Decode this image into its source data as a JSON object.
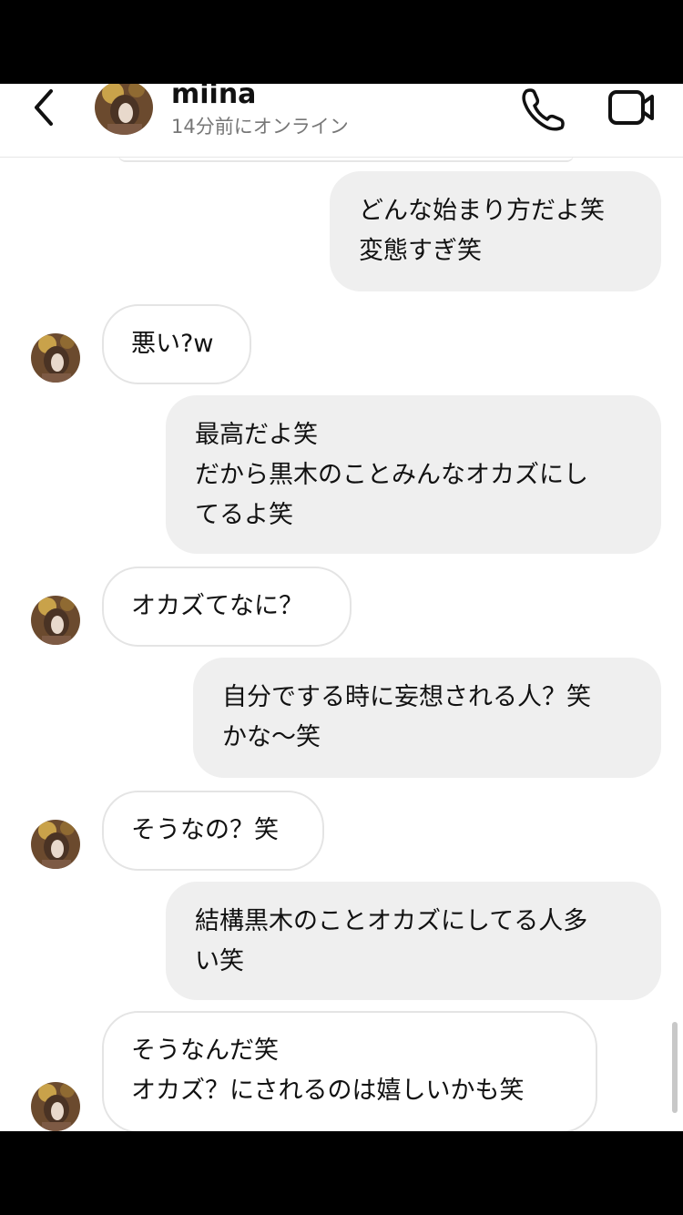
{
  "header": {
    "contact_name": "miina",
    "status": "14分前にオンライン"
  },
  "icons": {
    "back": "chevron-left-icon",
    "call": "phone-icon",
    "video": "video-camera-icon"
  },
  "messages": [
    {
      "from": "me",
      "lines": [
        "どんな始まり方だよ笑",
        "変態すぎ笑"
      ]
    },
    {
      "from": "them",
      "lines": [
        "悪い?w"
      ]
    },
    {
      "from": "me",
      "lines": [
        "最高だよ笑",
        "だから黒木のことみんなオカズにし",
        "てるよ笑"
      ]
    },
    {
      "from": "them",
      "lines": [
        "オカズてなに？"
      ]
    },
    {
      "from": "me",
      "lines": [
        "自分でする時に妄想される人？笑",
        "かな〜笑"
      ]
    },
    {
      "from": "them",
      "lines": [
        "そうなの？笑"
      ]
    },
    {
      "from": "me",
      "lines": [
        "結構黒木のことオカズにしてる人多",
        "い笑"
      ]
    },
    {
      "from": "them",
      "lines": [
        "そうなんだ笑",
        "オカズ？にされるのは嬉しいかも笑"
      ]
    }
  ]
}
